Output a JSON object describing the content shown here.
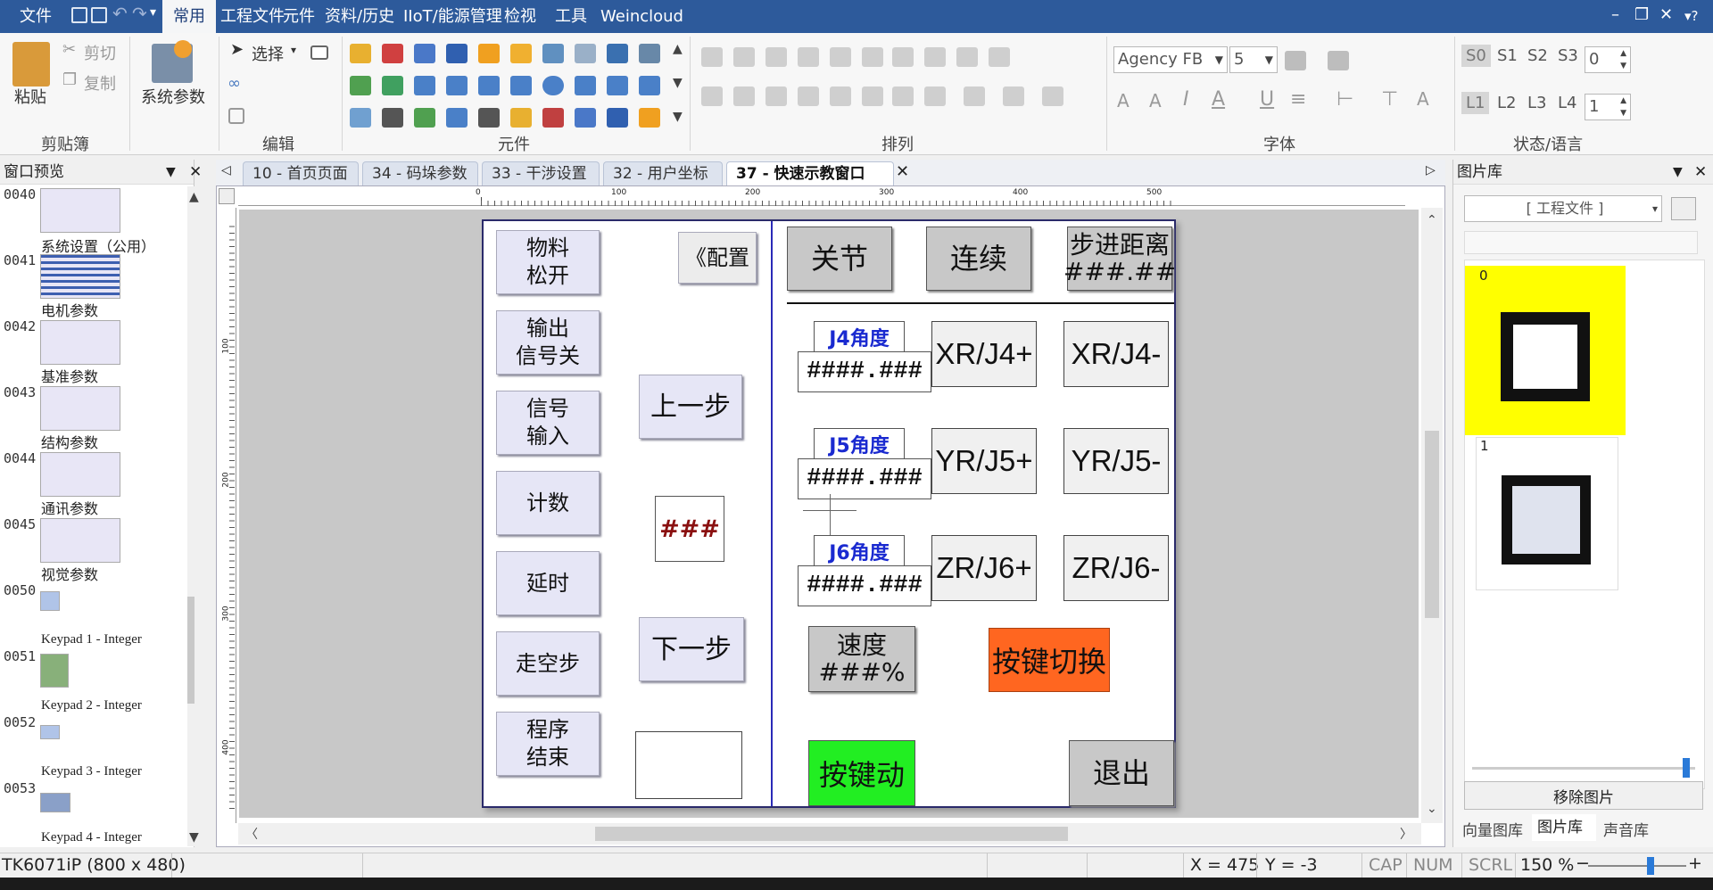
{
  "menubar": {
    "items": [
      "文件",
      "常用",
      "工程文件",
      "元件",
      "资料/历史",
      "IIoT/能源管理",
      "检视",
      "工具",
      "Weincloud"
    ],
    "active": "常用"
  },
  "ribbon": {
    "clipboard": {
      "paste": "粘贴",
      "cut": "剪切",
      "copy": "复制",
      "group": "剪贴簿"
    },
    "sysparam": "系统参数",
    "edit": {
      "select": "选择",
      "group": "编辑"
    },
    "elements_group": "元件",
    "arrange_group": "排列",
    "font": {
      "name": "Agency FB",
      "size": "5",
      "group": "字体"
    },
    "state": {
      "s_labels": [
        "S0",
        "S1",
        "S2",
        "S3"
      ],
      "s_value": "0",
      "l_labels": [
        "L1",
        "L2",
        "L3",
        "L4"
      ],
      "l_value": "1",
      "group": "状态/语言"
    }
  },
  "left_pane": {
    "title": "窗口预览",
    "items": [
      {
        "num": "0040",
        "label": "系统设置（公用）"
      },
      {
        "num": "0041",
        "label": "电机参数"
      },
      {
        "num": "0042",
        "label": "基准参数"
      },
      {
        "num": "0043",
        "label": "结构参数"
      },
      {
        "num": "0044",
        "label": "通讯参数"
      },
      {
        "num": "0045",
        "label": "视觉参数"
      },
      {
        "num": "0050",
        "label": "Keypad 1 - Integer"
      },
      {
        "num": "0051",
        "label": "Keypad 2 - Integer"
      },
      {
        "num": "0052",
        "label": "Keypad 3 - Integer"
      },
      {
        "num": "0053",
        "label": "Keypad 4 - Integer"
      }
    ]
  },
  "tabs": [
    {
      "label": "10 - 首页页面"
    },
    {
      "label": "34 - 码垛参数"
    },
    {
      "label": "33 - 干涉设置"
    },
    {
      "label": "32 - 用户坐标"
    },
    {
      "label": "37 - 快速示教窗口",
      "active": true
    }
  ],
  "ruler": {
    "labels": [
      "0",
      "100",
      "200",
      "300",
      "400",
      "500"
    ],
    "v_labels": [
      "100",
      "200",
      "300",
      "400"
    ]
  },
  "hmi": {
    "left_buttons": [
      "物料\n松开",
      "输出\n信号关",
      "信号\n输入",
      "计数",
      "延时",
      "走空步",
      "程序\n结束"
    ],
    "config": "《配置",
    "prev": "上一步",
    "next": "下一步",
    "counter": "###",
    "top_buttons": {
      "joint": "关节",
      "continuous": "连续",
      "step": "步进距离\n###.##"
    },
    "joint_labels": [
      "J4角度",
      "J5角度",
      "J6角度"
    ],
    "angle_value": "####.###",
    "jog": [
      [
        "XR/J4+",
        "XR/J4-"
      ],
      [
        "YR/J5+",
        "YR/J5-"
      ],
      [
        "ZR/J6+",
        "ZR/J6-"
      ]
    ],
    "speed": "速度\n###%",
    "key_switch": "按键切换",
    "key_jog": "按键动",
    "exit": "退出"
  },
  "right_pane": {
    "title": "图片库",
    "dropdown": "[ 工程文件 ]",
    "images": [
      "0",
      "1"
    ],
    "remove": "移除图片",
    "tabs": [
      "向量图库",
      "图片库",
      "声音库"
    ],
    "active_tab": "图片库"
  },
  "status": {
    "device": "TK6071iP (800 x 480)",
    "x": "X = 475",
    "y": "Y = -3",
    "cap": "CAP",
    "num": "NUM",
    "scrl": "SCRL",
    "zoom": "150 %"
  },
  "colors": {
    "accent": "#2d5a9b",
    "green": "#22ee22",
    "orange": "#ff6620",
    "yellow": "#ffff00"
  }
}
